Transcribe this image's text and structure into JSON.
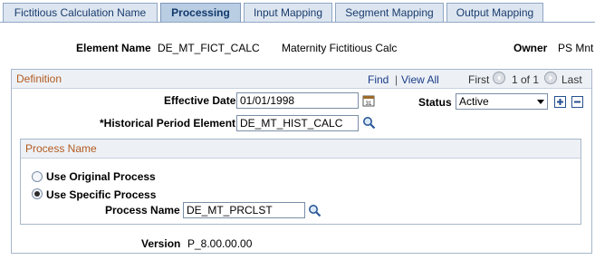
{
  "tabs": [
    {
      "label": "Fictitious Calculation Name",
      "active": false
    },
    {
      "label": "Processing",
      "active": true
    },
    {
      "label": "Input Mapping",
      "active": false
    },
    {
      "label": "Segment Mapping",
      "active": false
    },
    {
      "label": "Output Mapping",
      "active": false
    }
  ],
  "header": {
    "element_name_label": "Element Name",
    "element_name_value": "DE_MT_FICT_CALC",
    "element_description": "Maternity Fictitious Calc",
    "owner_label": "Owner",
    "owner_value": "PS Mnt"
  },
  "definition": {
    "title": "Definition",
    "find_label": "Find",
    "view_all_label": "View All",
    "separator": "|",
    "first_label": "First",
    "count_label": "1 of 1",
    "last_label": "Last",
    "effective_date_label": "Effective Date",
    "effective_date_value": "01/01/1998",
    "status_label": "Status",
    "status_value": "Active",
    "hist_period_label": "*Historical Period Element",
    "hist_period_value": "DE_MT_HIST_CALC"
  },
  "process_name": {
    "title": "Process Name",
    "option_original_label": "Use Original Process",
    "option_specific_label": "Use Specific Process",
    "selected": "specific",
    "process_name_label": "Process Name",
    "process_name_value": "DE_MT_PRCLST"
  },
  "version": {
    "label": "Version",
    "value": "P_8.00.00.00"
  },
  "colors": {
    "section_title": "#b35a1f",
    "link": "#1a3c88",
    "tab_active": "#b9cde3",
    "tab_inactive": "#dde6f0"
  },
  "icons": [
    "calendar-icon",
    "search-icon",
    "add-row-icon",
    "delete-row-icon",
    "prev-arrow-icon",
    "next-arrow-icon"
  ]
}
